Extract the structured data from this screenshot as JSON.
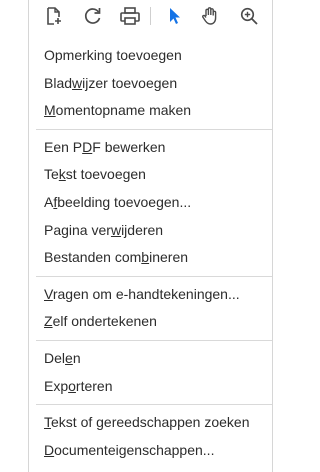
{
  "toolbar": {
    "icons": [
      "page-setup-icon",
      "refresh-icon",
      "print-icon",
      "select-arrow-icon",
      "hand-tool-icon",
      "zoom-in-icon"
    ],
    "accent": "#1473e6",
    "icon_color": "#4b4b4b"
  },
  "menu": {
    "groups": [
      [
        {
          "before": "Opmerking toevoegen",
          "u": "",
          "after": ""
        },
        {
          "before": "Blad",
          "u": "w",
          "after": "ijzer toevoegen"
        },
        {
          "before": "",
          "u": "M",
          "after": "omentopname maken"
        }
      ],
      [
        {
          "before": "Een P",
          "u": "D",
          "after": "F bewerken"
        },
        {
          "before": "Te",
          "u": "k",
          "after": "st toevoegen"
        },
        {
          "before": "A",
          "u": "f",
          "after": "beelding toevoegen..."
        },
        {
          "before": "Pagina ver",
          "u": "w",
          "after": "ijderen"
        },
        {
          "before": "Bestanden com",
          "u": "b",
          "after": "ineren"
        }
      ],
      [
        {
          "before": "",
          "u": "V",
          "after": "ragen om e-handtekeningen..."
        },
        {
          "before": "",
          "u": "Z",
          "after": "elf ondertekenen"
        }
      ],
      [
        {
          "before": "Del",
          "u": "e",
          "after": "n"
        },
        {
          "before": "Exp",
          "u": "o",
          "after": "rteren"
        }
      ],
      [
        {
          "before": "",
          "u": "T",
          "after": "ekst of gereedschappen zoeken"
        },
        {
          "before": "",
          "u": "D",
          "after": "ocumenteigenschappen..."
        }
      ]
    ]
  }
}
